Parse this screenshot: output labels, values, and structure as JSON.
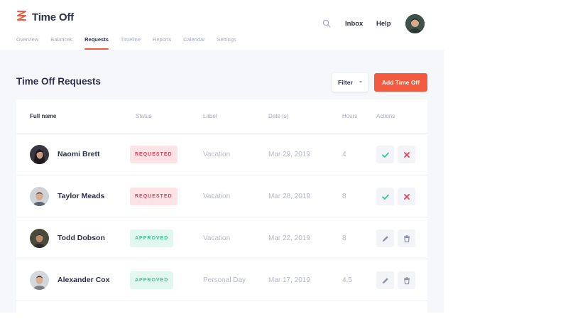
{
  "app": {
    "title": "Time Off",
    "accent_color": "#f25a3f",
    "logo_icon": "zigzag-logo-icon"
  },
  "nav": {
    "items": [
      {
        "label": "Overview",
        "active": false
      },
      {
        "label": "Balances",
        "active": false
      },
      {
        "label": "Requests",
        "active": true
      },
      {
        "label": "Timeline",
        "active": false
      },
      {
        "label": "Reports",
        "active": false
      },
      {
        "label": "Calendar",
        "active": false
      },
      {
        "label": "Settings",
        "active": false
      }
    ]
  },
  "header": {
    "search_icon": "search-icon",
    "inbox_label": "Inbox",
    "help_label": "Help",
    "avatar_icon": "user-avatar"
  },
  "page": {
    "title": "Time Off Requests",
    "filter_label": "Filter",
    "add_label": "Add Time Off"
  },
  "table": {
    "columns": [
      "Full name",
      "Status",
      "Label",
      "Date (s)",
      "Hours",
      "Actions"
    ],
    "rows": [
      {
        "name": "Naomi Brett",
        "status": "REQUESTED",
        "status_type": "requested",
        "label": "Vacation",
        "date": "Mar 29, 2019",
        "hours": "4",
        "actions": [
          "check-icon",
          "close-icon"
        ]
      },
      {
        "name": "Taylor Meads",
        "status": "REQUESTED",
        "status_type": "requested",
        "label": "Vacation",
        "date": "Mar 28, 2019",
        "hours": "8",
        "actions": [
          "check-icon",
          "close-icon"
        ]
      },
      {
        "name": "Todd Dobson",
        "status": "APPROVED",
        "status_type": "approved",
        "label": "Vacation",
        "date": "Mar 22, 2019",
        "hours": "8",
        "actions": [
          "pencil-icon",
          "trash-icon"
        ]
      },
      {
        "name": "Alexander Cox",
        "status": "APPROVED",
        "status_type": "approved",
        "label": "Personal Day",
        "date": "Mar 17, 2019",
        "hours": "4,5",
        "actions": [
          "pencil-icon",
          "trash-icon"
        ]
      }
    ]
  },
  "colors": {
    "requested_bg": "#fde3e6",
    "requested_text": "#e0435a",
    "approved_bg": "#e2f7ef",
    "approved_text": "#3cc58d",
    "approve_action": "#3cc58d",
    "reject_action": "#e0435a"
  }
}
